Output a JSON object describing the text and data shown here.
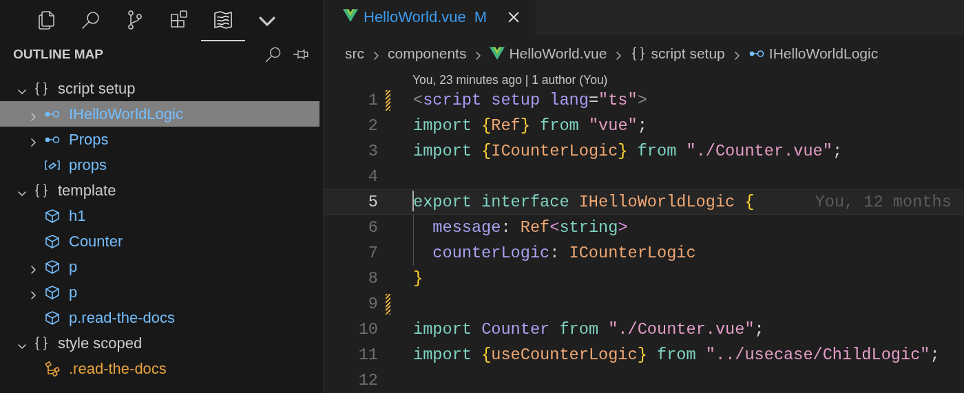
{
  "activity_bar": [
    {
      "kind": "files",
      "selected": false
    },
    {
      "kind": "search",
      "selected": false
    },
    {
      "kind": "source-control",
      "selected": false
    },
    {
      "kind": "extensions",
      "selected": false
    },
    {
      "kind": "map",
      "selected": true
    }
  ],
  "panel": {
    "title": "OUTLINE MAP"
  },
  "outline": [
    {
      "kind": "scope",
      "label": "script setup",
      "expanded": true,
      "selected": false,
      "children": [
        {
          "kind": "interface",
          "label": "IHelloWorldLogic",
          "expanded": false,
          "selected": true
        },
        {
          "kind": "interface",
          "label": "Props",
          "expanded": false,
          "selected": false
        },
        {
          "kind": "variable",
          "label": "props",
          "selected": false
        }
      ]
    },
    {
      "kind": "scope",
      "label": "template",
      "expanded": true,
      "selected": false,
      "children": [
        {
          "kind": "element",
          "label": "h1",
          "selected": false
        },
        {
          "kind": "element",
          "label": "Counter",
          "selected": false
        },
        {
          "kind": "element",
          "label": "p",
          "expanded": false,
          "selected": false
        },
        {
          "kind": "element",
          "label": "p",
          "expanded": false,
          "selected": false
        },
        {
          "kind": "element",
          "label": "p.read-the-docs",
          "selected": false
        }
      ]
    },
    {
      "kind": "scope",
      "label": "style scoped",
      "expanded": true,
      "selected": false,
      "children": [
        {
          "kind": "selector",
          "label": ".read-the-docs",
          "selected": false
        }
      ]
    }
  ],
  "editor": {
    "tabs": [
      {
        "label": "HelloWorld.vue",
        "badge": "M",
        "selected": true
      }
    ],
    "breadcrumbs": [
      {
        "kind": "folder",
        "label": "src"
      },
      {
        "kind": "folder",
        "label": "components"
      },
      {
        "kind": "vue",
        "label": "HelloWorld.vue"
      },
      {
        "kind": "scope",
        "label": "script setup"
      },
      {
        "kind": "interface",
        "label": "IHelloWorldLogic"
      }
    ],
    "codelens": "You, 23 minutes ago | 1 author (You)",
    "lines": [
      {
        "number": "1",
        "current": false,
        "modified": true,
        "tokens": [
          {
            "kind": "punct",
            "text": "<"
          },
          {
            "kind": "tag",
            "text": "script setup lang"
          },
          {
            "kind": "plain",
            "text": "="
          },
          {
            "kind": "string",
            "text": "\"ts\""
          },
          {
            "kind": "punct",
            "text": ">"
          }
        ]
      },
      {
        "number": "2",
        "current": false,
        "modified": false,
        "tokens": [
          {
            "kind": "keyword",
            "text": "import "
          },
          {
            "kind": "brace",
            "text": "{"
          },
          {
            "kind": "type",
            "text": "Ref"
          },
          {
            "kind": "brace",
            "text": "} "
          },
          {
            "kind": "keyword",
            "text": "from "
          },
          {
            "kind": "string",
            "text": "\"vue\""
          },
          {
            "kind": "plain",
            "text": ";"
          }
        ]
      },
      {
        "number": "3",
        "current": false,
        "modified": false,
        "tokens": [
          {
            "kind": "keyword",
            "text": "import "
          },
          {
            "kind": "brace",
            "text": "{"
          },
          {
            "kind": "type",
            "text": "ICounterLogic"
          },
          {
            "kind": "brace",
            "text": "} "
          },
          {
            "kind": "keyword",
            "text": "from "
          },
          {
            "kind": "string",
            "text": "\"./Counter.vue\""
          },
          {
            "kind": "plain",
            "text": ";"
          }
        ]
      },
      {
        "number": "4",
        "current": false,
        "modified": false
      },
      {
        "number": "5",
        "current": true,
        "modified": false,
        "blame": "You, 12 months",
        "tokens": [
          {
            "kind": "keyword",
            "text": "export interface "
          },
          {
            "kind": "type",
            "text": "IHelloWorldLogic "
          },
          {
            "kind": "brace",
            "text": "{"
          }
        ]
      },
      {
        "number": "6",
        "current": false,
        "modified": false,
        "indented": true,
        "tokens": [
          {
            "kind": "prop",
            "text": "message"
          },
          {
            "kind": "plain",
            "text": ": "
          },
          {
            "kind": "type",
            "text": "Ref"
          },
          {
            "kind": "angle",
            "text": "<"
          },
          {
            "kind": "keyword",
            "text": "string"
          },
          {
            "kind": "angle",
            "text": ">"
          }
        ]
      },
      {
        "number": "7",
        "current": false,
        "modified": false,
        "indented": true,
        "tokens": [
          {
            "kind": "prop",
            "text": "counterLogic"
          },
          {
            "kind": "plain",
            "text": ": "
          },
          {
            "kind": "type",
            "text": "ICounterLogic"
          }
        ]
      },
      {
        "number": "8",
        "current": false,
        "modified": false,
        "tokens": [
          {
            "kind": "brace",
            "text": "}"
          }
        ]
      },
      {
        "number": "9",
        "current": false,
        "modified": true
      },
      {
        "number": "10",
        "current": false,
        "modified": false,
        "tokens": [
          {
            "kind": "keyword",
            "text": "import "
          },
          {
            "kind": "prop",
            "text": "Counter "
          },
          {
            "kind": "keyword",
            "text": "from "
          },
          {
            "kind": "string",
            "text": "\"./Counter.vue\""
          },
          {
            "kind": "plain",
            "text": ";"
          }
        ]
      },
      {
        "number": "11",
        "current": false,
        "modified": false,
        "tokens": [
          {
            "kind": "keyword",
            "text": "import "
          },
          {
            "kind": "brace",
            "text": "{"
          },
          {
            "kind": "type",
            "text": "useCounterLogic"
          },
          {
            "kind": "brace",
            "text": "} "
          },
          {
            "kind": "keyword",
            "text": "from "
          },
          {
            "kind": "string",
            "text": "\"../usecase/ChildLogic\""
          },
          {
            "kind": "plain",
            "text": ";"
          }
        ]
      },
      {
        "number": "12",
        "current": false,
        "modified": false
      }
    ]
  }
}
